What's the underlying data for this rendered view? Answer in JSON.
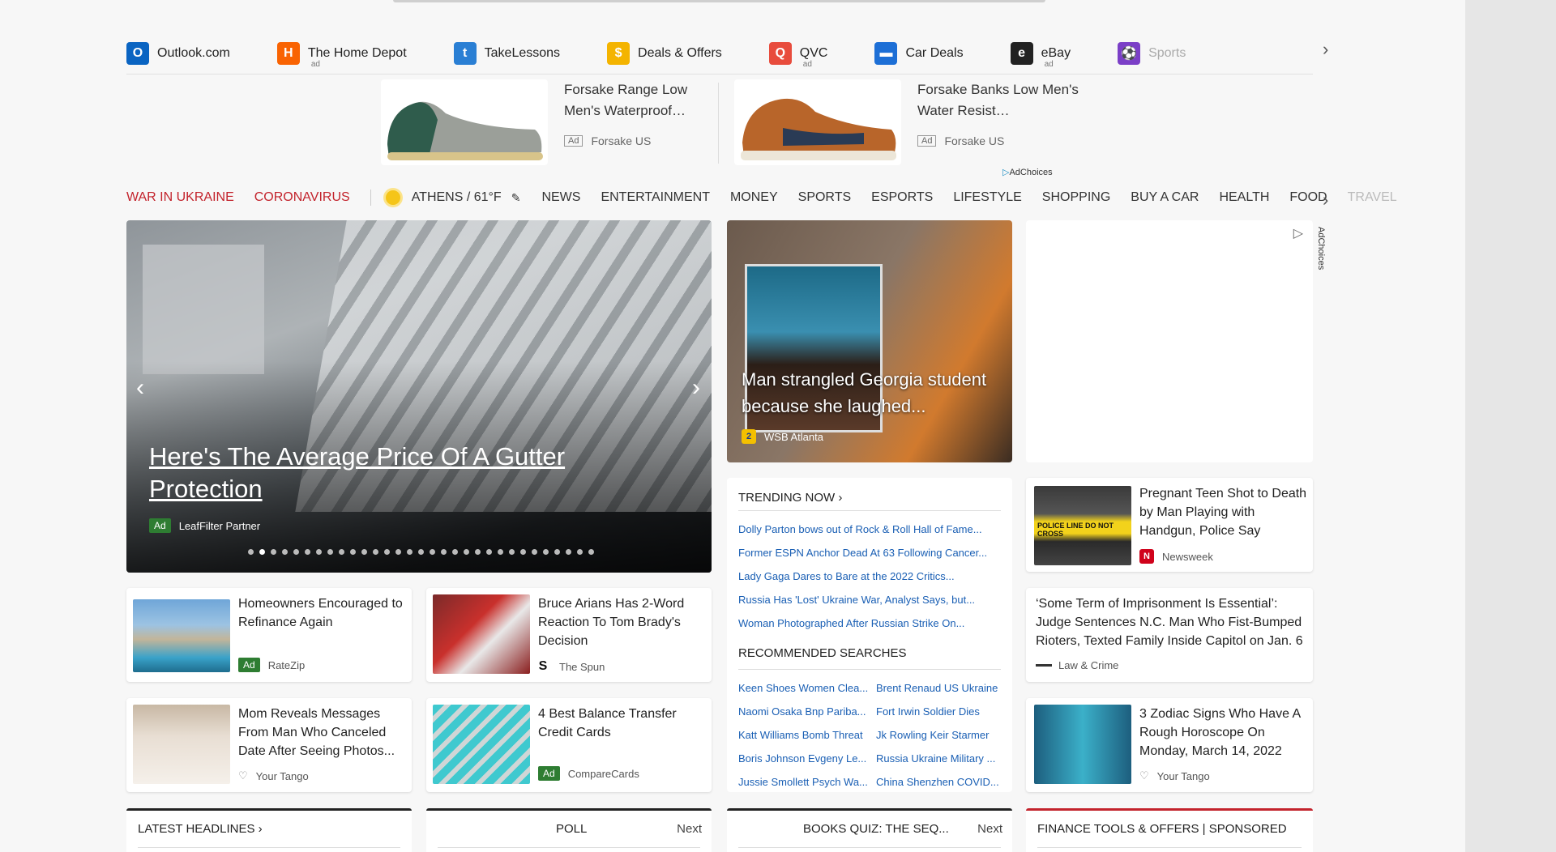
{
  "quicklinks": [
    {
      "label": "Outlook.com",
      "ad": "",
      "icon": "outlook-icon",
      "color": "#0a64c2",
      "glyph": "O"
    },
    {
      "label": "The Home Depot",
      "ad": "ad",
      "icon": "homedepot-icon",
      "color": "#f96302",
      "glyph": "H"
    },
    {
      "label": "TakeLessons",
      "ad": "",
      "icon": "takelessons-icon",
      "color": "#2a7fd4",
      "glyph": "t"
    },
    {
      "label": "Deals & Offers",
      "ad": "",
      "icon": "deals-icon",
      "color": "#f4b400",
      "glyph": "$"
    },
    {
      "label": "QVC",
      "ad": "ad",
      "icon": "qvc-icon",
      "color": "#e84c3d",
      "glyph": "Q"
    },
    {
      "label": "Car Deals",
      "ad": "",
      "icon": "car-icon",
      "color": "#1d6fd6",
      "glyph": "▬"
    },
    {
      "label": "eBay",
      "ad": "ad",
      "icon": "ebay-icon",
      "color": "#222",
      "glyph": "e"
    },
    {
      "label": "Sports",
      "ad": "",
      "icon": "sports-icon",
      "color": "#7b3fc7",
      "glyph": "⚽"
    }
  ],
  "ads": [
    {
      "title": "Forsake Range Low Men's Waterproof…",
      "badge": "Ad",
      "source": "Forsake US"
    },
    {
      "title": "Forsake Banks Low Men's Water Resist…",
      "badge": "Ad",
      "source": "Forsake US"
    }
  ],
  "adchoices": "AdChoices",
  "nav": {
    "red": [
      "WAR IN UKRAINE",
      "CORONAVIRUS"
    ],
    "weather": "ATHENS / 61°F",
    "items": [
      "NEWS",
      "ENTERTAINMENT",
      "MONEY",
      "SPORTS",
      "ESPORTS",
      "LIFESTYLE",
      "SHOPPING",
      "BUY A CAR",
      "HEALTH",
      "FOOD"
    ],
    "faded": "TRAVEL"
  },
  "hero": {
    "title": "Here's The Average Price Of A Gutter Protection",
    "badge": "Ad",
    "source": "LeafFilter Partner",
    "dot_count": 31,
    "active_dot": 2
  },
  "center_story": {
    "title": "Man strangled Georgia student because she laughed...",
    "source": "WSB Atlanta"
  },
  "cards": [
    {
      "title": "Homeowners Encouraged to Refinance Again",
      "ad": "Ad",
      "source": "RateZip"
    },
    {
      "title": "Bruce Arians Has 2-Word Reaction To Tom Brady's Decision",
      "ad": "",
      "source": "The Spun"
    },
    {
      "title": "Mom Reveals Messages From Man Who Canceled Date After Seeing Photos...",
      "ad": "",
      "source": "Your Tango"
    },
    {
      "title": "4 Best Balance Transfer Credit Cards",
      "ad": "Ad",
      "source": "CompareCards"
    },
    {
      "title": "Pregnant Teen Shot to Death by Man Playing with Handgun, Police Say",
      "ad": "",
      "source": "Newsweek"
    },
    {
      "title": "‘Some Term of Imprisonment Is Essential’: Judge Sentences N.C. Man Who Fist-Bumped Rioters, Texted Family Inside Capitol on Jan. 6",
      "ad": "",
      "source": "Law & Crime"
    },
    {
      "title": "3 Zodiac Signs Who Have A Rough Horoscope On Monday, March 14, 2022",
      "ad": "",
      "source": "Your Tango"
    }
  ],
  "trending": {
    "heading": "TRENDING NOW",
    "items": [
      "Dolly Parton bows out of Rock & Roll Hall of Fame...",
      "Former ESPN Anchor Dead At 63 Following Cancer...",
      "Lady Gaga Dares to Bare at the 2022 Critics...",
      "Russia Has 'Lost' Ukraine War, Analyst Says, but...",
      "Woman Photographed After Russian Strike On..."
    ],
    "rec_heading": "RECOMMENDED SEARCHES",
    "rec_left": [
      "Keen Shoes Women Clea...",
      "Naomi Osaka Bnp Pariba...",
      "Katt Williams Bomb Threat",
      "Boris Johnson Evgeny Le...",
      "Jussie Smollett Psych Wa..."
    ],
    "rec_right": [
      "Brent Renaud US Ukraine",
      "Fort Irwin Soldier Dies",
      "Jk Rowling Keir Starmer",
      "Russia Ukraine Military ...",
      "China Shenzhen COVID..."
    ]
  },
  "bottom": {
    "latest": "LATEST HEADLINES",
    "poll": "POLL",
    "poll_next": "Next",
    "quiz": "BOOKS QUIZ: THE SEQ...",
    "quiz_next": "Next",
    "finance": "FINANCE TOOLS & OFFERS | SPONSORED"
  }
}
